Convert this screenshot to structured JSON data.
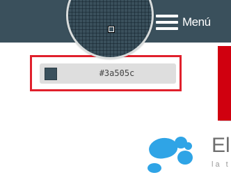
{
  "header": {
    "menu_label": "Menú",
    "background_color": "#3a505c",
    "menu_icon": "hamburger-icon"
  },
  "color_picker": {
    "selected_value": "#3a505c",
    "swatch_color": "#3a505c",
    "highlight_color": "#e0202c"
  },
  "logo": {
    "text": "El",
    "subtext": "la t",
    "color": "#2fa4e6"
  },
  "accent_colors": {
    "red_block": "#d0000f"
  }
}
